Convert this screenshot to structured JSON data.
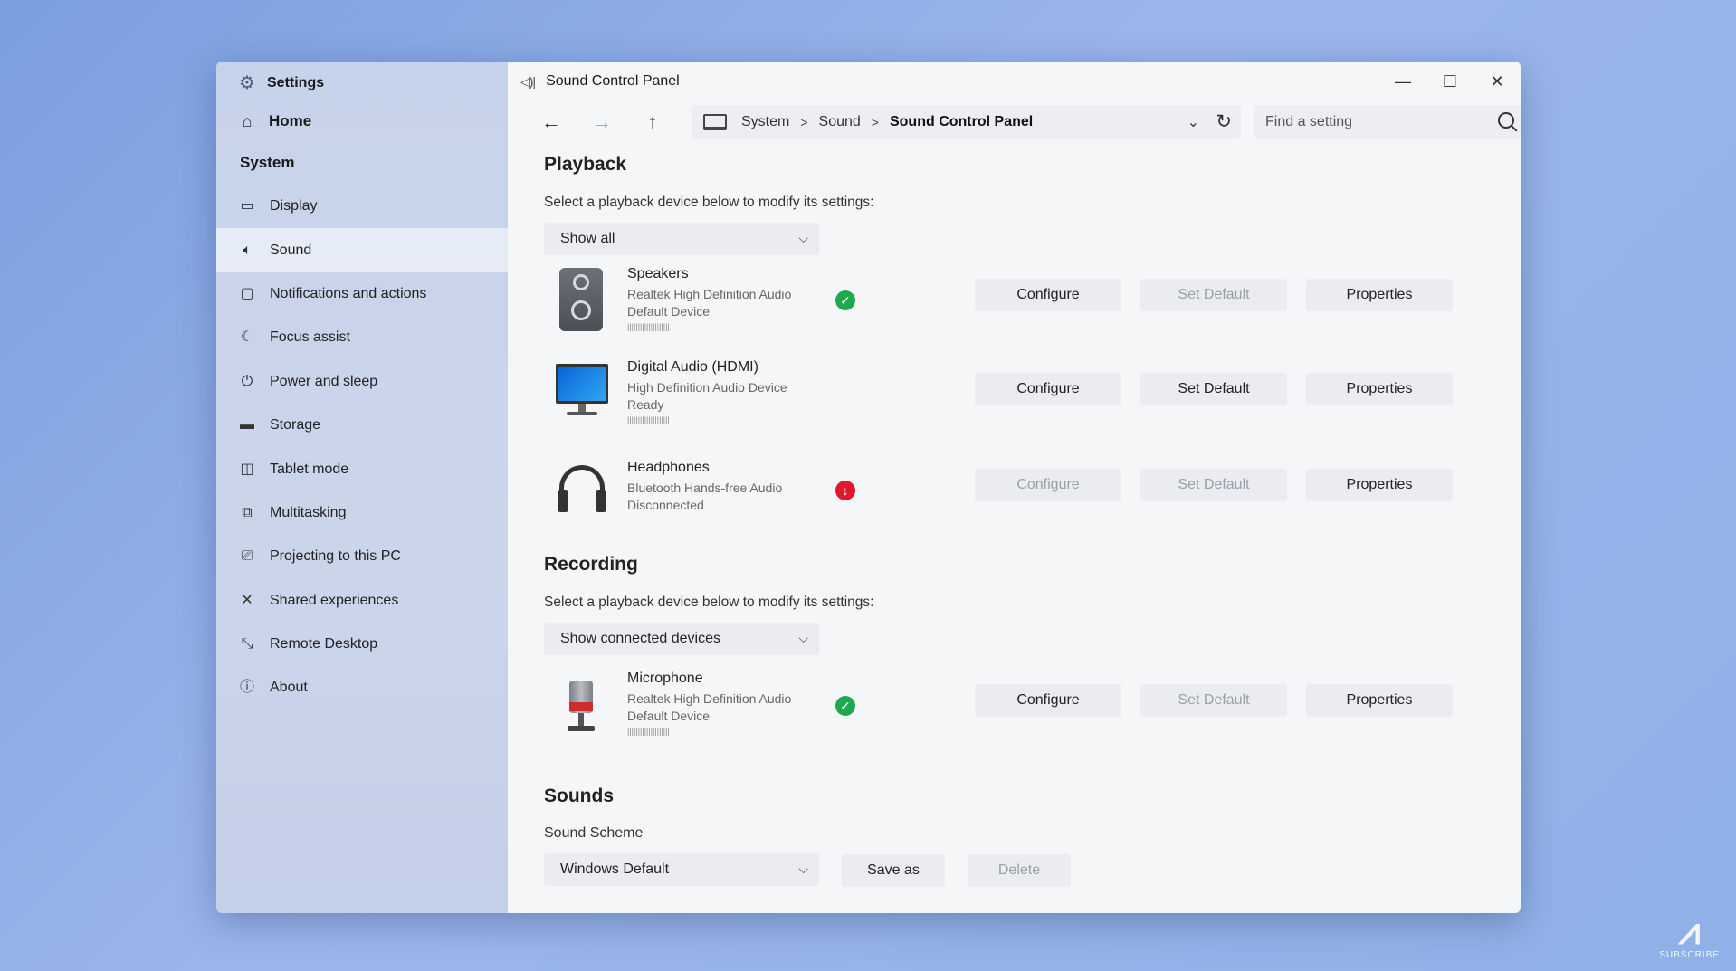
{
  "sidebar": {
    "title": "Settings",
    "home": "Home",
    "section": "System",
    "items": [
      {
        "label": "Display",
        "icon": "display-icon"
      },
      {
        "label": "Sound",
        "icon": "sound-icon"
      },
      {
        "label": "Notifications and actions",
        "icon": "notifications-icon"
      },
      {
        "label": "Focus assist",
        "icon": "moon-icon"
      },
      {
        "label": "Power and sleep",
        "icon": "power-icon"
      },
      {
        "label": "Storage",
        "icon": "storage-icon"
      },
      {
        "label": "Tablet mode",
        "icon": "tablet-icon"
      },
      {
        "label": "Multitasking",
        "icon": "multitasking-icon"
      },
      {
        "label": "Projecting to this PC",
        "icon": "projecting-icon"
      },
      {
        "label": "Shared experiences",
        "icon": "shared-icon"
      },
      {
        "label": "Remote Desktop",
        "icon": "remote-icon"
      },
      {
        "label": "About",
        "icon": "info-icon"
      }
    ]
  },
  "window": {
    "title": "Sound Control Panel"
  },
  "address": {
    "crumbs": [
      "System",
      "Sound",
      "Sound Control Panel"
    ]
  },
  "search": {
    "placeholder": "Find a setting"
  },
  "playback": {
    "heading": "Playback",
    "description": "Select a playback device below to modify its settings:",
    "filter": "Show all",
    "devices": [
      {
        "name": "Speakers",
        "line1": "Realtek High Definition Audio",
        "line2": "Default Device",
        "level": "||||||||||||||||||||",
        "status": "ok",
        "status_glyph": "✓",
        "configure": "Configure",
        "set_default": "Set Default",
        "properties": "Properties"
      },
      {
        "name": "Digital Audio (HDMI)",
        "line1": "High Definition Audio Device",
        "line2": "Ready",
        "level": "||||||||||||||||||||",
        "configure": "Configure",
        "set_default": "Set Default",
        "properties": "Properties"
      },
      {
        "name": "Headphones",
        "line1": "Bluetooth Hands-free Audio",
        "line2": "Disconnected",
        "status": "err",
        "status_glyph": "↓",
        "configure": "Configure",
        "set_default": "Set Default",
        "properties": "Properties"
      }
    ]
  },
  "recording": {
    "heading": "Recording",
    "description": "Select a playback device below to modify its settings:",
    "filter": "Show connected devices",
    "devices": [
      {
        "name": "Microphone",
        "line1": "Realtek High Definition Audio",
        "line2": "Default Device",
        "level": "||||||||||||||||||||",
        "status": "ok",
        "status_glyph": "✓",
        "configure": "Configure",
        "set_default": "Set Default",
        "properties": "Properties"
      }
    ]
  },
  "sounds": {
    "heading": "Sounds",
    "scheme_label": "Sound Scheme",
    "scheme": "Windows Default",
    "save_as": "Save as",
    "delete": "Delete"
  },
  "watermark": {
    "sub": "SUBSCRIBE"
  },
  "colors": {
    "ok": "#1fa84f",
    "error": "#e0182d",
    "sidebar": "#c7d3ea",
    "background": "#8fb0e8"
  }
}
